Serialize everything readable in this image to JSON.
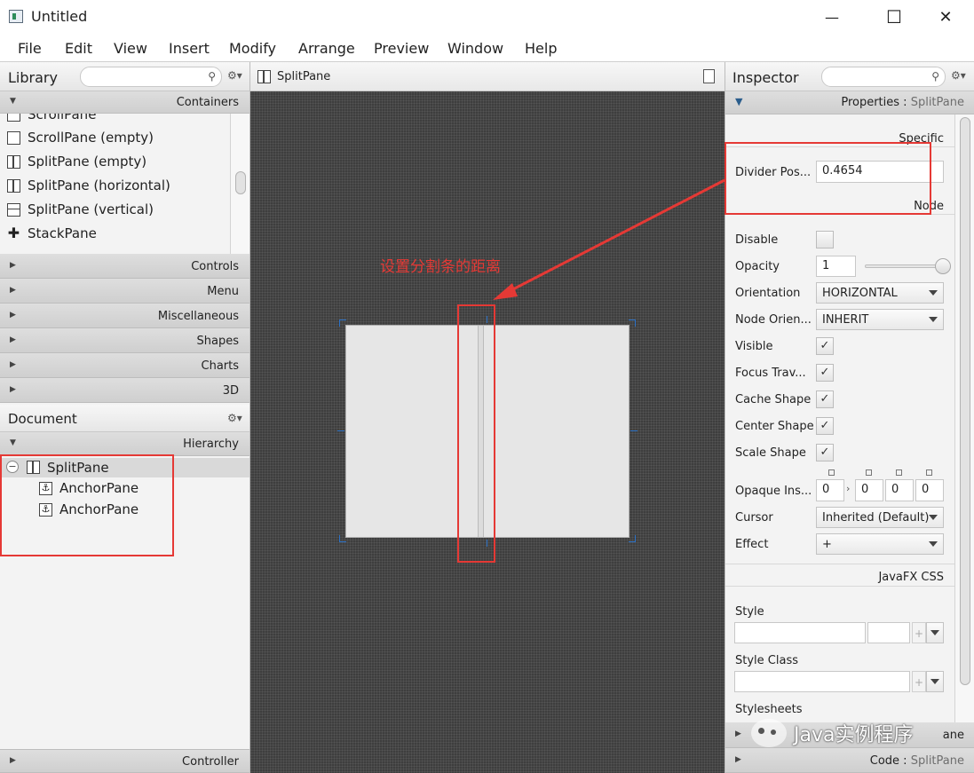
{
  "window": {
    "title": "Untitled",
    "min_glyph": "—",
    "max_glyph": "☐",
    "close_glyph": "✕"
  },
  "menu": [
    "File",
    "Edit",
    "View",
    "Insert",
    "Modify",
    "Arrange",
    "Preview",
    "Window",
    "Help"
  ],
  "library": {
    "title": "Library",
    "containers_label": "Containers",
    "items": [
      {
        "label": "ScrollPane",
        "cut": true
      },
      {
        "label": "ScrollPane  (empty)"
      },
      {
        "label": "SplitPane  (empty)"
      },
      {
        "label": "SplitPane  (horizontal)"
      },
      {
        "label": "SplitPane  (vertical)"
      },
      {
        "label": "StackPane"
      }
    ],
    "sections": [
      "Controls",
      "Menu",
      "Miscellaneous",
      "Shapes",
      "Charts",
      "3D"
    ]
  },
  "document": {
    "title": "Document",
    "hierarchy_label": "Hierarchy",
    "root": "SplitPane",
    "children": [
      "AnchorPane",
      "AnchorPane"
    ],
    "controller_label": "Controller"
  },
  "canvas": {
    "tab": "SplitPane",
    "annotation": "设置分割条的距离",
    "divider_position": 0.4654
  },
  "inspector": {
    "title": "Inspector",
    "properties_prefix": "Properties :",
    "properties_target": "SplitPane",
    "specific_label": "Specific",
    "divider_label": "Divider Pos...",
    "divider_value": "0.4654",
    "node_label": "Node",
    "disable_label": "Disable",
    "opacity_label": "Opacity",
    "opacity_value": "1",
    "opacity_slider": 1,
    "orientation_label": "Orientation",
    "orientation_value": "HORIZONTAL",
    "node_orient_label": "Node Orien...",
    "node_orient_value": "INHERIT",
    "visible_label": "Visible",
    "focus_label": "Focus Trav...",
    "cache_label": "Cache Shape",
    "center_label": "Center Shape",
    "scale_label": "Scale Shape",
    "check_glyph": "✓",
    "opaque_label": "Opaque Ins...",
    "opaque_values": [
      "0",
      "0",
      "0",
      "0"
    ],
    "cursor_label": "Cursor",
    "cursor_value": "Inherited (Default)",
    "effect_label": "Effect",
    "effect_value": "+",
    "javafx_css_label": "JavaFX CSS",
    "style_label": "Style",
    "style_class_label": "Style Class",
    "stylesheets_label": "Stylesheets",
    "layout_label": "ane",
    "code_prefix": "Code :",
    "code_target": "SplitPane"
  },
  "watermark": "Java实例程序",
  "colors": {
    "annotation": "#e53935",
    "accent": "#2196f3"
  }
}
